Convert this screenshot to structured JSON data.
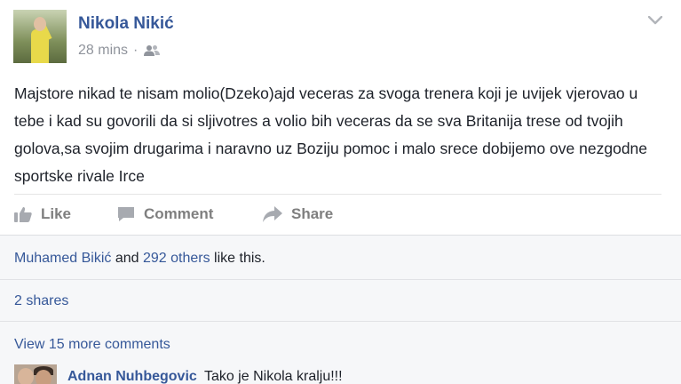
{
  "post": {
    "author_name": "Nikola Nikić",
    "time": "28 mins",
    "separator": "·",
    "audience_icon": "friends-icon",
    "options_icon": "chevron-down-icon",
    "text": "Majstore nikad te nisam molio(Dzeko)ajd veceras za svoga trenera koji je uvijek vjerovao u tebe i kad su govorili da si sljivotres a volio bih veceras da se sva Britanija trese od tvojih golova,sa svojim drugarima i naravno uz Boziju pomoc i malo srece dobijemo ove nezgodne sportske rivale Irce"
  },
  "actions": {
    "like_label": "Like",
    "comment_label": "Comment",
    "share_label": "Share",
    "icon_color": "#7f7f7f"
  },
  "feedback": {
    "likes": {
      "liker_name": "Muhamed Bikić",
      "connector": "and",
      "others_label": "292 others",
      "suffix": "like this."
    },
    "shares_label": "2 shares",
    "more_comments_label": "View 15 more comments",
    "comment": {
      "author": "Adnan Nuhbegovic",
      "text": "Tako je Nikola kralju!!!"
    }
  },
  "colors": {
    "link": "#365899",
    "text": "#1d2129",
    "meta": "#90949c",
    "feedback_bg": "#f6f7f9"
  }
}
